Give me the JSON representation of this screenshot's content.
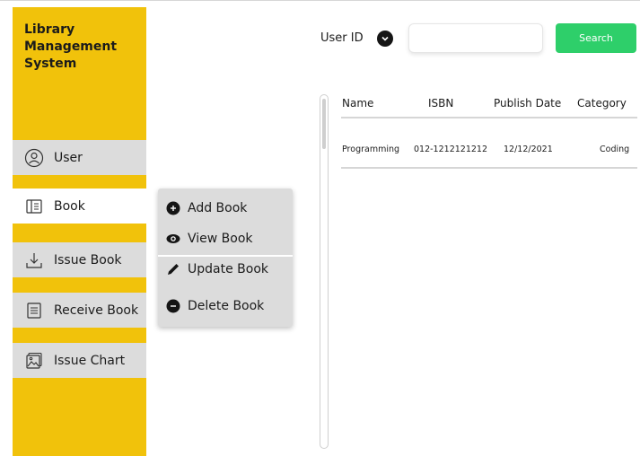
{
  "sidebar": {
    "title": "Library\nManagement\nSystem",
    "accent_color": "#f1c20b",
    "items": [
      {
        "label": "User",
        "icon": "user-icon"
      },
      {
        "label": "Book",
        "icon": "book-icon",
        "active": true
      },
      {
        "label": "Issue Book",
        "icon": "download-icon"
      },
      {
        "label": "Receive Book",
        "icon": "document-icon"
      },
      {
        "label": "Issue Chart",
        "icon": "image-icon"
      }
    ]
  },
  "book_menu": {
    "items": [
      {
        "label": "Add Book",
        "icon": "plus-circle-icon"
      },
      {
        "label": "View Book",
        "icon": "eye-icon"
      },
      {
        "label": "Update Book",
        "icon": "pencil-icon"
      },
      {
        "label": "Delete Book",
        "icon": "minus-circle-icon"
      }
    ]
  },
  "search": {
    "label": "User ID",
    "value": "",
    "placeholder": "",
    "button_label": "Search",
    "button_color": "#2ecf6a"
  },
  "table": {
    "columns": [
      "Name",
      "ISBN",
      "Publish Date",
      "Category"
    ],
    "rows": [
      [
        "Programming",
        "012-1212121212",
        "12/12/2021",
        "Coding"
      ]
    ]
  }
}
